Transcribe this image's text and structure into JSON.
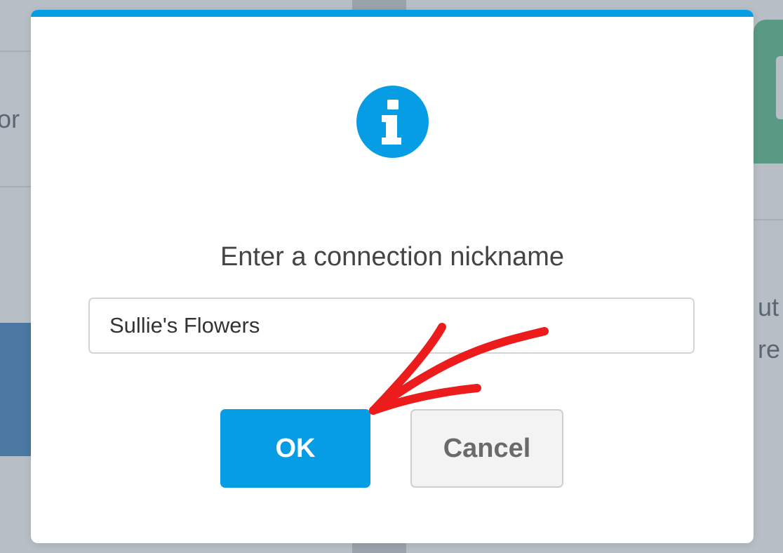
{
  "background": {
    "left_text_fragment": "or",
    "right_text_fragment_1": "ut",
    "right_text_fragment_2": "re"
  },
  "dialog": {
    "icon": "info-icon",
    "prompt": "Enter a connection nickname",
    "input": {
      "value": "Sullie's Flowers",
      "placeholder": ""
    },
    "ok_label": "OK",
    "cancel_label": "Cancel"
  },
  "annotation": {
    "icon": "red-arrow-pointing-to-ok-button"
  },
  "colors": {
    "accent": "#069de4",
    "arrow": "#ec1c1c",
    "dialog_background": "#ffffff",
    "overlay": "#b7bec5",
    "prompt_text": "#444444",
    "cancel_text": "#6a6a6a"
  }
}
